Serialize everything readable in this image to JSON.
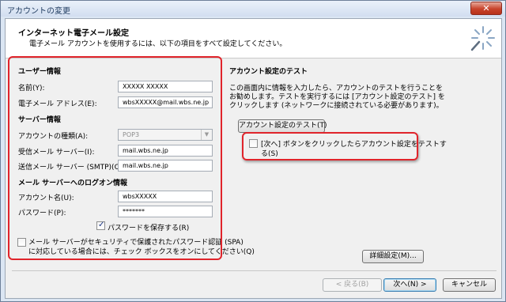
{
  "window": {
    "title": "アカウントの変更",
    "close_label": "✕"
  },
  "header": {
    "title": "インターネット電子メール設定",
    "subtitle": "電子メール アカウントを使用するには、以下の項目をすべて設定してください。",
    "icon": "wizard-sparkle-icon"
  },
  "user_info": {
    "heading": "ユーザー情報",
    "name_label": "名前(Y):",
    "name_value": "XXXXX XXXXX",
    "email_label": "電子メール アドレス(E):",
    "email_value": "wbsXXXXX@mail.wbs.ne.jp"
  },
  "server_info": {
    "heading": "サーバー情報",
    "account_type_label": "アカウントの種類(A):",
    "account_type_value": "POP3",
    "incoming_label": "受信メール サーバー(I):",
    "incoming_value": "mail.wbs.ne.jp",
    "outgoing_label": "送信メール サーバー (SMTP)(O):",
    "outgoing_value": "mail.wbs.ne.jp"
  },
  "logon_info": {
    "heading": "メール サーバーへのログオン情報",
    "account_name_label": "アカウント名(U):",
    "account_name_value": "wbsXXXXX",
    "password_label": "パスワード(P):",
    "password_value": "*******",
    "remember_password_label": "パスワードを保存する(R)",
    "remember_password_checked": true,
    "spa_label_line1": "メール サーバーがセキュリティで保護されたパスワード認証 (SPA)",
    "spa_label_line2": "に対応している場合には、チェック ボックスをオンにしてください(Q)",
    "spa_checked": false
  },
  "test_section": {
    "heading": "アカウント設定のテスト",
    "description_line1": "この画面内に情報を入力したら、アカウントのテストを行うことを",
    "description_line2": "お勧めします。テストを実行するには [アカウント設定のテスト] を",
    "description_line3": "クリックします (ネットワークに接続されている必要があります)。",
    "test_button_label": "アカウント設定のテスト(T)",
    "auto_test_label_line1": "[次へ] ボタンをクリックしたらアカウント設定をテストす",
    "auto_test_label_line2": "る(S)",
    "auto_test_checked": false
  },
  "buttons": {
    "more_settings": "詳細設定(M)...",
    "back": "< 戻る(B)",
    "next": "次へ(N) >",
    "cancel": "キャンセル"
  },
  "colors": {
    "highlight_red": "#e0242b",
    "accent_blue": "#3c7fb1"
  }
}
